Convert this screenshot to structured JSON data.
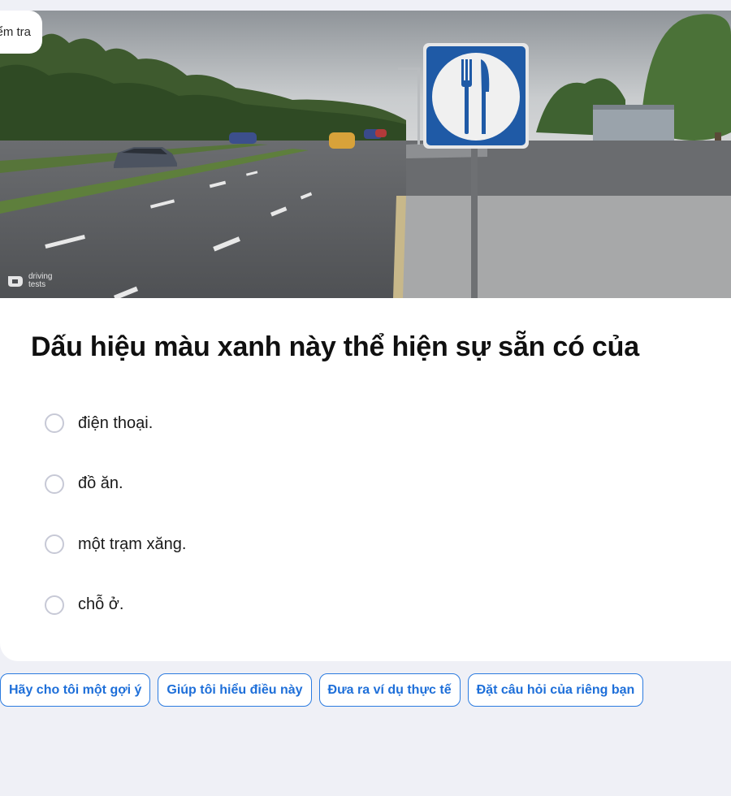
{
  "header": {
    "badge_label": "Kiểm tra"
  },
  "image": {
    "watermark_line1": "driving",
    "watermark_line2": "tests"
  },
  "question": {
    "text": "Dấu hiệu màu xanh này thể hiện sự sẵn có của",
    "options": [
      {
        "label": "điện thoại."
      },
      {
        "label": "đồ ăn."
      },
      {
        "label": "một trạm xăng."
      },
      {
        "label": "chỗ ở."
      }
    ]
  },
  "suggestions": [
    {
      "label": "Hãy cho tôi một gợi ý"
    },
    {
      "label": "Giúp tôi hiểu điều này"
    },
    {
      "label": "Đưa ra ví dụ thực tế"
    },
    {
      "label": "Đặt câu hỏi của riêng bạn"
    }
  ],
  "colors": {
    "page_bg": "#eff0f6",
    "card_bg": "#ffffff",
    "accent": "#1e6fd9",
    "sign_blue": "#1f5aa6"
  }
}
